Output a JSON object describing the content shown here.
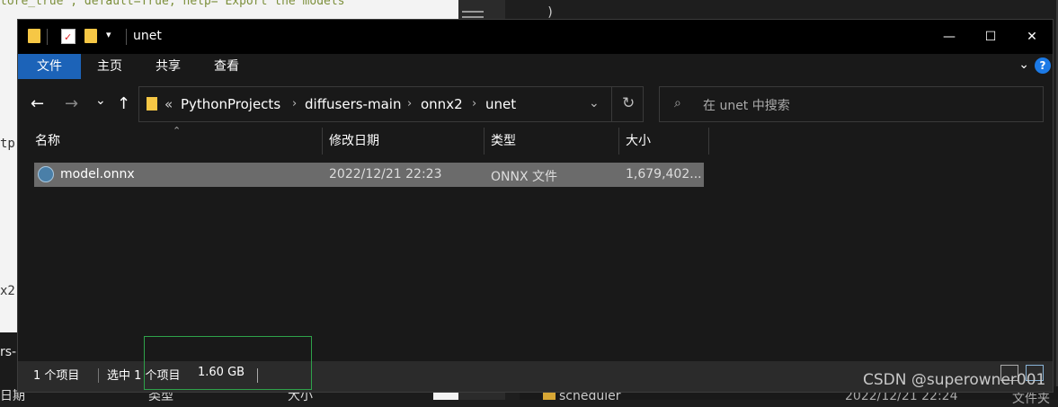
{
  "background": {
    "code_line": "tore_true', default=True, help='Export the models'",
    "frag_tp": "tp",
    "frag_x2": "x2",
    "frag_rs": "rs-",
    "bottom_left_col1": "日期",
    "bottom_left_col2": "类型",
    "bottom_left_col3": "大小",
    "bottom_right_folder": "scheduler",
    "bottom_right_date": "2022/12/21 22:24",
    "bottom_right_type": "文件夹",
    "right_top_code": ")"
  },
  "window": {
    "title": "unet",
    "controls": {
      "minimize": "—",
      "maximize": "☐",
      "close": "✕"
    }
  },
  "ribbon": {
    "tabs": [
      {
        "label": "文件",
        "active": true
      },
      {
        "label": "主页"
      },
      {
        "label": "共享"
      },
      {
        "label": "查看"
      }
    ],
    "help": "?"
  },
  "nav": {
    "back": "←",
    "forward": "→",
    "recent": "⌄",
    "up": "↑",
    "overflow": "«",
    "breadcrumb": [
      "PythonProjects",
      "diffusers-main",
      "onnx2",
      "unet"
    ],
    "refresh": "↻",
    "search_placeholder": "在 unet 中搜索"
  },
  "columns": {
    "name": "名称",
    "date": "修改日期",
    "type": "类型",
    "size": "大小"
  },
  "files": [
    {
      "name": "model.onnx",
      "date": "2022/12/21 22:23",
      "type": "ONNX 文件",
      "size": "1,679,402..."
    }
  ],
  "status": {
    "count": "1 个项目",
    "selected": "选中 1 个项目",
    "selected_size": "1.60 GB"
  },
  "watermark": "CSDN @superowner001",
  "colors": {
    "accent": "#1c63b8",
    "highlight": "#2ea24a",
    "selection": "#6b6b6b"
  }
}
